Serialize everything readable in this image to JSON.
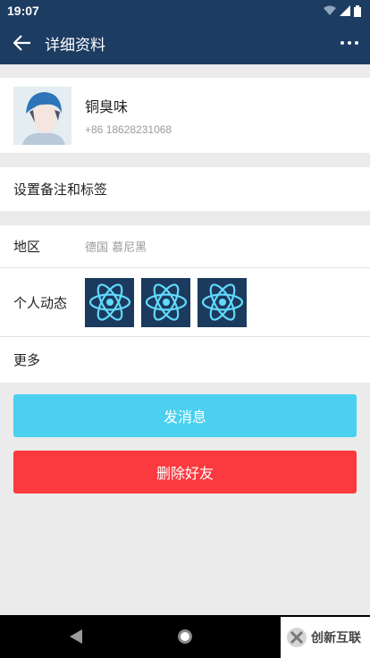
{
  "status_bar": {
    "time": "19:07"
  },
  "app_bar": {
    "title": "详细资料"
  },
  "profile": {
    "name": "铜臭味",
    "phone": "+86 18628231068"
  },
  "rows": {
    "remark": "设置备注和标签",
    "region_label": "地区",
    "region_value": "德国 慕尼黑",
    "moments_label": "个人动态",
    "more": "更多"
  },
  "buttons": {
    "send_message": "发消息",
    "delete_friend": "删除好友"
  },
  "watermark": {
    "text": "创新互联"
  },
  "colors": {
    "header": "#1d3c62",
    "send_button": "#4bd0f0",
    "delete_button": "#fb3a3f",
    "react_icon": "#61dafb"
  }
}
